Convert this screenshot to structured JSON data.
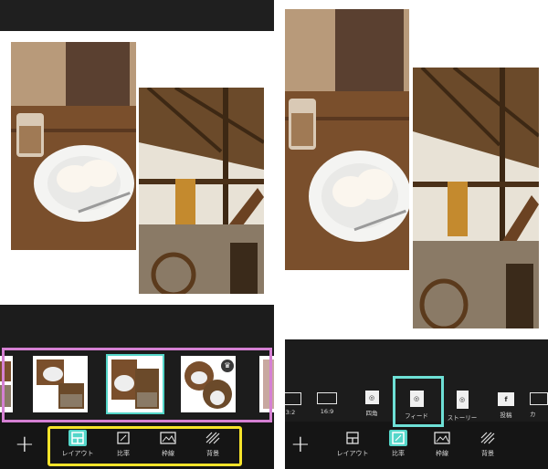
{
  "left_screen": {
    "bottom_toolbar": {
      "add_label": "+",
      "tools": [
        {
          "label": "レイアウト",
          "icon": "layout-icon",
          "active": true
        },
        {
          "label": "比率",
          "icon": "ratio-icon",
          "active": false
        },
        {
          "label": "枠線",
          "icon": "border-icon",
          "active": false
        },
        {
          "label": "背景",
          "icon": "background-icon",
          "active": false
        }
      ]
    },
    "layout_thumbnails": [
      {
        "name": "layout-partial",
        "selected": false
      },
      {
        "name": "layout-diagonal",
        "selected": false
      },
      {
        "name": "layout-staggered",
        "selected": true
      },
      {
        "name": "layout-circles",
        "selected": false,
        "premium_icon": "crown-icon"
      },
      {
        "name": "layout-partial-right",
        "selected": false
      }
    ]
  },
  "right_screen": {
    "ratio_options": [
      {
        "label": "3:2",
        "icon": "rect-icon"
      },
      {
        "label": "16:9",
        "icon": "rect-icon"
      },
      {
        "label": "四角",
        "icon": "instagram-icon"
      },
      {
        "label": "フィード",
        "icon": "instagram-icon",
        "selected": true
      },
      {
        "label": "ストーリー",
        "icon": "instagram-icon"
      },
      {
        "label": "投稿",
        "icon": "facebook-icon",
        "glyph": "f"
      },
      {
        "label": "カ",
        "icon": "rect-icon"
      }
    ],
    "bottom_toolbar": {
      "add_label": "+",
      "tools": [
        {
          "label": "レイアウト",
          "icon": "layout-icon",
          "active": false
        },
        {
          "label": "比率",
          "icon": "ratio-icon",
          "active": true
        },
        {
          "label": "枠線",
          "icon": "border-icon",
          "active": false
        },
        {
          "label": "背景",
          "icon": "background-icon",
          "active": false
        }
      ]
    }
  },
  "colors": {
    "accent_teal": "#54d6c9",
    "highlight_pink": "#d580d3",
    "highlight_yellow": "#f5e32a",
    "highlight_cyan": "#6ee0d6"
  }
}
